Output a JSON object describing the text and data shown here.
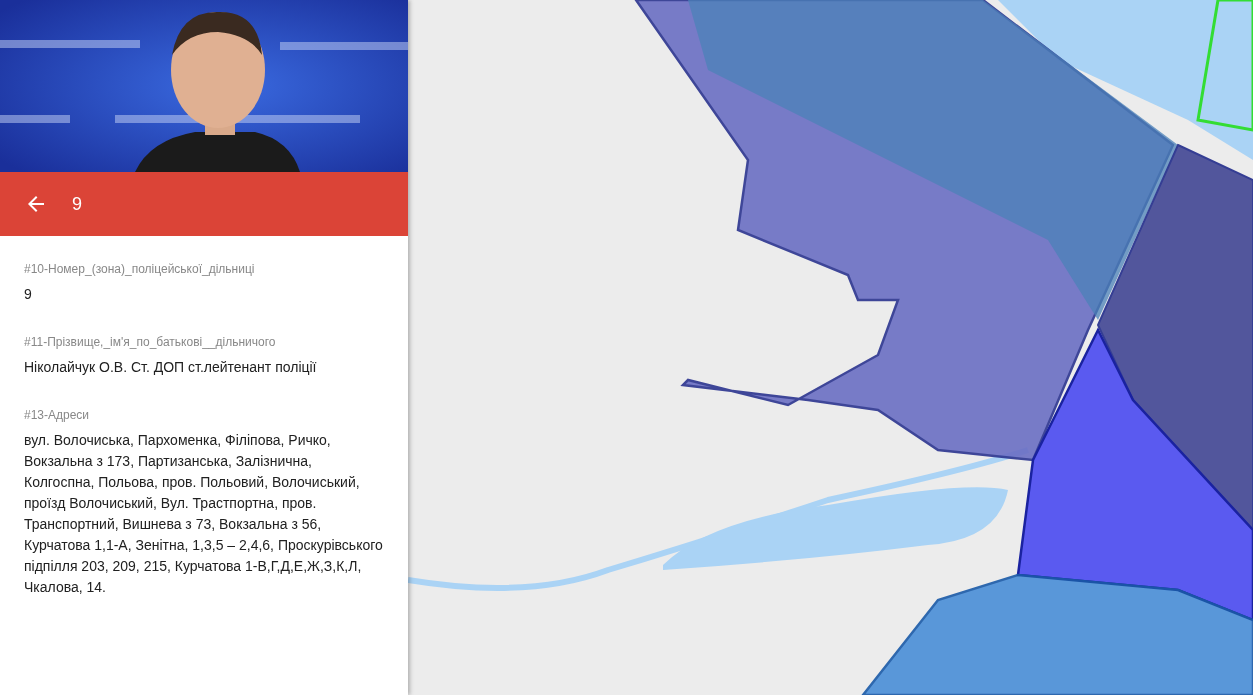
{
  "header": {
    "title": "9"
  },
  "fields": [
    {
      "label": "#10-Номер_(зона)_поліцейської_дільниці",
      "value": "9"
    },
    {
      "label": "#11-Прізвище,_ім'я_по_батькові__дільничого",
      "value": "Ніколайчук О.В. Ст. ДОП ст.лейтенант поліції"
    },
    {
      "label": "#13-Адреси",
      "value": "вул. Волочиська, Пархоменка, Філіпова, Ричко, Вокзальна з 173, Партизанська, Залізнична, Колгоспна, Польова, пров. Польовий, Волочиський, проїзд Волочиський, Вул. Трастпортна, пров. Транспортний, Вишнева з 73, Вокзальна з 56, Курчатова 1,1-А, Зенітна, 1,3,5 – 2,4,6, Проскурівського підпілля 203, 209, 215, Курчатова 1-В,Г,Д,Е,Ж,З,К,Л, Чкалова, 14."
    }
  ]
}
